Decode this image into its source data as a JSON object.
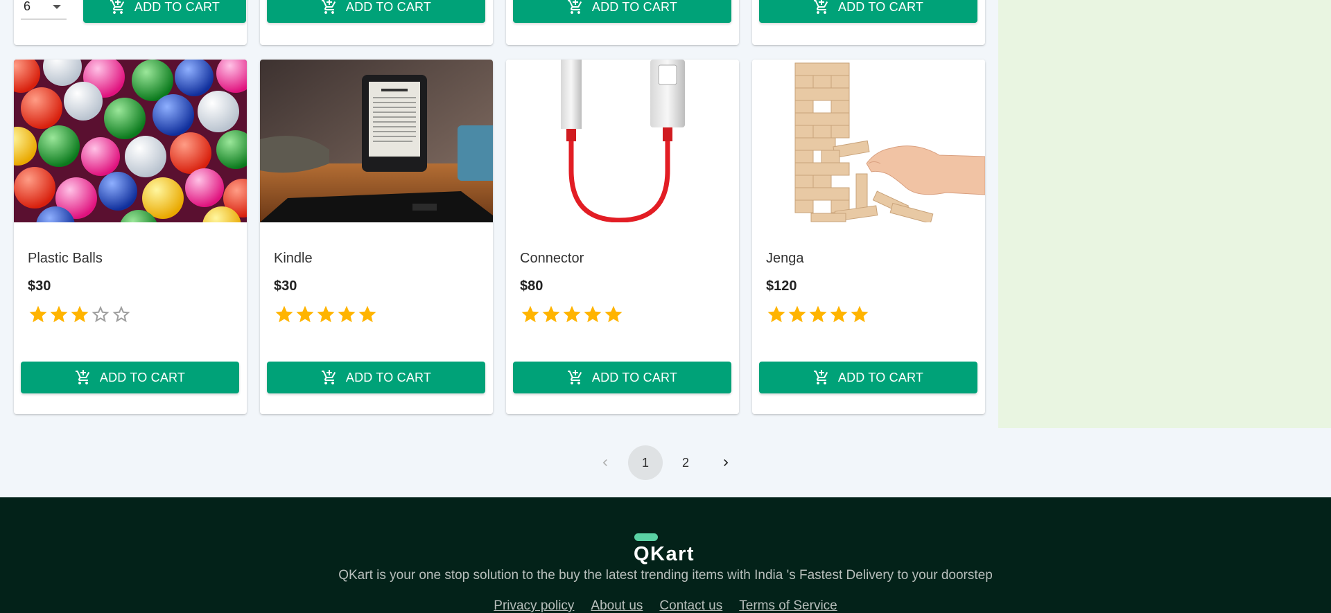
{
  "colors": {
    "accent": "#00a278",
    "star": "#ffb400",
    "footer_bg": "#032219",
    "side_panel": "#e9f5e1"
  },
  "top_row": {
    "quantity_value": "6",
    "buttons": [
      "ADD TO CART",
      "ADD TO CART",
      "ADD TO CART",
      "ADD TO CART"
    ]
  },
  "products": [
    {
      "name": "Plastic Balls",
      "price": "$30",
      "rating": 3,
      "button": "ADD TO CART",
      "image_icon": "plastic-balls-image"
    },
    {
      "name": "Kindle",
      "price": "$30",
      "rating": 5,
      "button": "ADD TO CART",
      "image_icon": "kindle-image"
    },
    {
      "name": "Connector",
      "price": "$80",
      "rating": 5,
      "button": "ADD TO CART",
      "image_icon": "connector-image"
    },
    {
      "name": "Jenga",
      "price": "$120",
      "rating": 5,
      "button": "ADD TO CART",
      "image_icon": "jenga-image"
    }
  ],
  "pagination": {
    "pages": [
      "1",
      "2"
    ],
    "current": "1"
  },
  "footer": {
    "brand": "QKart",
    "tagline": "QKart is your one stop solution to the buy the latest trending items with India 's Fastest Delivery to your doorstep",
    "links": [
      "Privacy policy",
      "About us",
      "Contact us",
      "Terms of Service"
    ]
  }
}
